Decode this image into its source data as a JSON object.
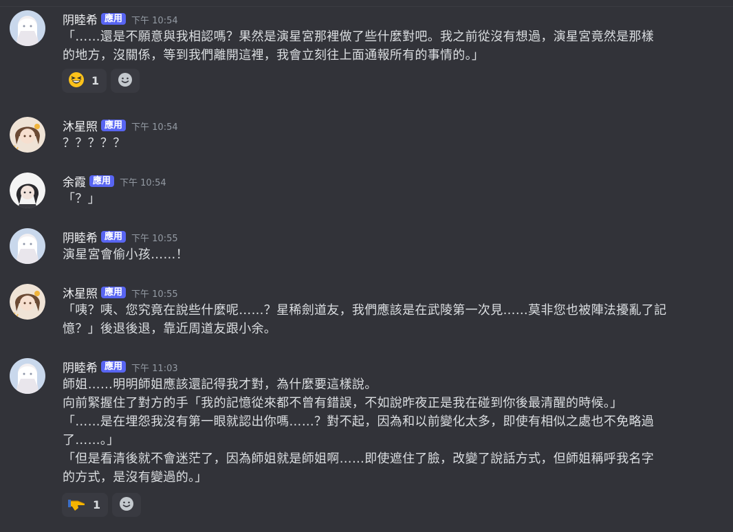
{
  "messages": [
    {
      "author": "阴睦希",
      "badge": "應用",
      "time": "下午 10:54",
      "avatar": "white-haired-girl-avatar",
      "lines": [
        "「……還是不願意與我相認嗎？果然是演星宮那裡做了些什麼對吧。我之前從沒有想過，演星宮竟然是那樣",
        "的地方，沒關係，等到我們離開這裡，我會立刻往上面通報所有的事情的。」"
      ],
      "reaction": {
        "emoji": "grinning-squinting-face",
        "count": "1"
      }
    },
    {
      "author": "沐星照",
      "badge": "應用",
      "time": "下午 10:54",
      "avatar": "brown-haired-girl-avatar",
      "lines": [
        "？？？？？"
      ]
    },
    {
      "author": "余霞",
      "badge": "應用",
      "time": "下午 10:54",
      "avatar": "dark-haired-girl-avatar",
      "lines": [
        "「？」"
      ]
    },
    {
      "author": "阴睦希",
      "badge": "應用",
      "time": "下午 10:55",
      "avatar": "white-haired-girl-avatar",
      "lines": [
        "演星宮會偷小孩……！"
      ]
    },
    {
      "author": "沐星照",
      "badge": "應用",
      "time": "下午 10:55",
      "avatar": "brown-haired-girl-avatar",
      "lines": [
        "「咦？咦、您究竟在說些什麼呢……？星稀劍道友，我們應該是在武陵第一次見……莫非您也被陣法擾亂了記",
        "憶？」後退後退，靠近周道友跟小余。"
      ]
    },
    {
      "author": "阴睦希",
      "badge": "應用",
      "time": "下午 11:03",
      "avatar": "white-haired-girl-avatar",
      "lines": [
        "師姐……明明師姐應該還記得我才對，為什麼要這樣說。",
        "向前緊握住了對方的手「我的記憶從來都不曾有錯誤，不如說昨夜正是我在碰到你後最清醒的時候。」",
        "「……是在埋怨我沒有第一眼就認出你嗎……？對不起，因為和以前變化太多，即使有相似之處也不免略過",
        "了……。」",
        "「但是看清後就不會迷茫了，因為師姐就是師姐啊……即使遮住了臉，改變了說話方式，但師姐稱呼我名字",
        "的方式，是沒有變過的。」"
      ],
      "reaction": {
        "emoji": "pointing-hand",
        "count": "1"
      }
    }
  ],
  "colors": {
    "background": "#323339",
    "badge": "#5865f2",
    "timestamp": "#949ba4",
    "text": "#dbdee1",
    "reaction_bg": "#393a41"
  },
  "icons": {
    "add_reaction": "smile-plus-icon"
  }
}
